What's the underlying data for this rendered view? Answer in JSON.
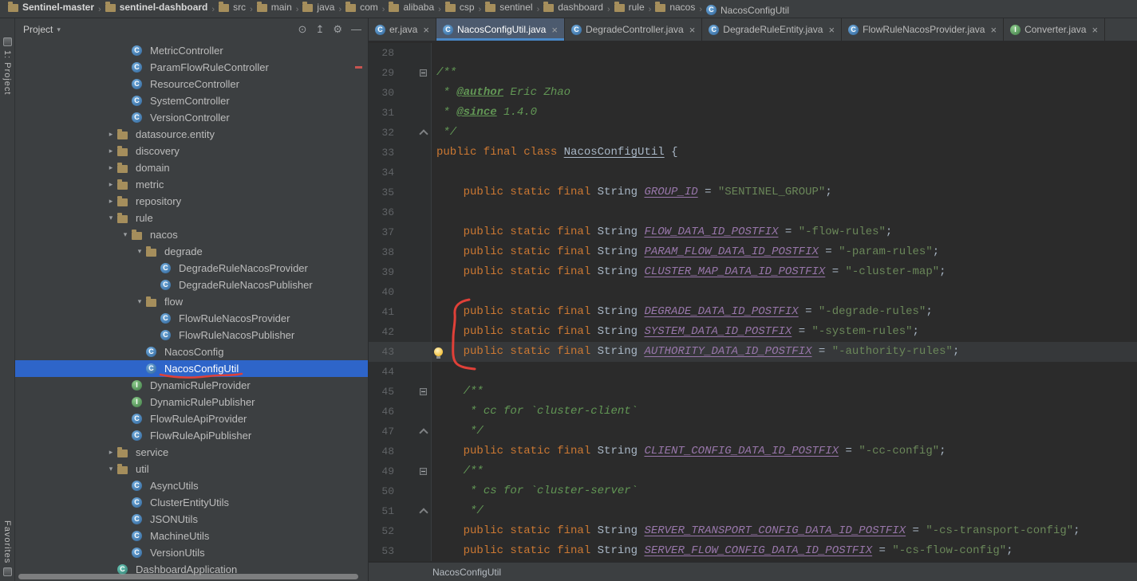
{
  "theme": {
    "panel_bg": "#3C3F41",
    "editor_bg": "#2B2B2B",
    "selection_blue": "#2E65C9",
    "tab_underline_blue": "#4A88C7",
    "annotation_red": "#E04038",
    "keyword_orange": "#CC7832",
    "string_green": "#6A8759",
    "constant_purple": "#9876AA"
  },
  "top_breadcrumbs": [
    {
      "label": "Sentinel-master",
      "icon": "folder",
      "bold": true
    },
    {
      "label": "sentinel-dashboard",
      "icon": "folder",
      "bold": true
    },
    {
      "label": "src",
      "icon": "folder",
      "bold": false
    },
    {
      "label": "main",
      "icon": "folder",
      "bold": false
    },
    {
      "label": "java",
      "icon": "folder",
      "bold": false
    },
    {
      "label": "com",
      "icon": "folder",
      "bold": false
    },
    {
      "label": "alibaba",
      "icon": "folder",
      "bold": false
    },
    {
      "label": "csp",
      "icon": "folder",
      "bold": false
    },
    {
      "label": "sentinel",
      "icon": "folder",
      "bold": false
    },
    {
      "label": "dashboard",
      "icon": "folder",
      "bold": false
    },
    {
      "label": "rule",
      "icon": "folder",
      "bold": false
    },
    {
      "label": "nacos",
      "icon": "folder",
      "bold": false
    },
    {
      "label": "NacosConfigUtil",
      "icon": "class",
      "bold": false
    }
  ],
  "tool_strip": {
    "top_label": "1: Project",
    "bottom_label": "Favorites"
  },
  "project_panel": {
    "title": "Project",
    "caret": "▾",
    "header_icons": [
      {
        "name": "locate-file-icon",
        "glyph": "⊙"
      },
      {
        "name": "collapse-all-icon",
        "glyph": "↥"
      },
      {
        "name": "settings-gear-icon",
        "glyph": "⚙"
      },
      {
        "name": "hide-panel-icon",
        "glyph": "—"
      }
    ],
    "tree": [
      {
        "label": "MetricController",
        "icon": "class",
        "depth": 7
      },
      {
        "label": "ParamFlowRuleController",
        "icon": "class",
        "depth": 7
      },
      {
        "label": "ResourceController",
        "icon": "class",
        "depth": 7
      },
      {
        "label": "SystemController",
        "icon": "class",
        "depth": 7
      },
      {
        "label": "VersionController",
        "icon": "class",
        "depth": 7
      },
      {
        "label": "datasource.entity",
        "icon": "folder",
        "depth": 6,
        "expand": "closed"
      },
      {
        "label": "discovery",
        "icon": "folder",
        "depth": 6,
        "expand": "closed"
      },
      {
        "label": "domain",
        "icon": "folder",
        "depth": 6,
        "expand": "closed"
      },
      {
        "label": "metric",
        "icon": "folder",
        "depth": 6,
        "expand": "closed"
      },
      {
        "label": "repository",
        "icon": "folder",
        "depth": 6,
        "expand": "closed"
      },
      {
        "label": "rule",
        "icon": "folder",
        "depth": 6,
        "expand": "open"
      },
      {
        "label": "nacos",
        "icon": "folder",
        "depth": 7,
        "expand": "open"
      },
      {
        "label": "degrade",
        "icon": "folder",
        "depth": 8,
        "expand": "open"
      },
      {
        "label": "DegradeRuleNacosProvider",
        "icon": "class",
        "depth": 9
      },
      {
        "label": "DegradeRuleNacosPublisher",
        "icon": "class",
        "depth": 9
      },
      {
        "label": "flow",
        "icon": "folder",
        "depth": 8,
        "expand": "open"
      },
      {
        "label": "FlowRuleNacosProvider",
        "icon": "class",
        "depth": 9
      },
      {
        "label": "FlowRuleNacosPublisher",
        "icon": "class",
        "depth": 9
      },
      {
        "label": "NacosConfig",
        "icon": "class",
        "depth": 8
      },
      {
        "label": "NacosConfigUtil",
        "icon": "class",
        "depth": 8,
        "selected": true
      },
      {
        "label": "DynamicRuleProvider",
        "icon": "interface",
        "depth": 7
      },
      {
        "label": "DynamicRulePublisher",
        "icon": "interface",
        "depth": 7
      },
      {
        "label": "FlowRuleApiProvider",
        "icon": "class",
        "depth": 7
      },
      {
        "label": "FlowRuleApiPublisher",
        "icon": "class",
        "depth": 7
      },
      {
        "label": "service",
        "icon": "folder",
        "depth": 6,
        "expand": "closed"
      },
      {
        "label": "util",
        "icon": "folder",
        "depth": 6,
        "expand": "open"
      },
      {
        "label": "AsyncUtils",
        "icon": "class",
        "depth": 7
      },
      {
        "label": "ClusterEntityUtils",
        "icon": "class",
        "depth": 7
      },
      {
        "label": "JSONUtils",
        "icon": "class",
        "depth": 7
      },
      {
        "label": "MachineUtils",
        "icon": "class",
        "depth": 7
      },
      {
        "label": "VersionUtils",
        "icon": "class",
        "depth": 7
      },
      {
        "label": "DashboardApplication",
        "icon": "app",
        "depth": 6
      }
    ]
  },
  "editor": {
    "tabs": [
      {
        "label": "er.java",
        "icon": "class",
        "active": false
      },
      {
        "label": "NacosConfigUtil.java",
        "icon": "class",
        "active": true
      },
      {
        "label": "DegradeController.java",
        "icon": "class",
        "active": false
      },
      {
        "label": "DegradeRuleEntity.java",
        "icon": "class",
        "active": false
      },
      {
        "label": "FlowRuleNacosProvider.java",
        "icon": "class",
        "active": false
      },
      {
        "label": "Converter.java",
        "icon": "interface",
        "active": false
      }
    ],
    "status_breadcrumb": "NacosConfigUtil",
    "lines": [
      {
        "no": 28,
        "seg": []
      },
      {
        "no": 29,
        "fold": "start",
        "seg": [
          {
            "s": "d",
            "t": "/**"
          }
        ]
      },
      {
        "no": 30,
        "seg": [
          {
            "s": "d",
            "t": " * "
          },
          {
            "s": "t",
            "t": "@author"
          },
          {
            "s": "d",
            "t": " Eric Zhao"
          }
        ]
      },
      {
        "no": 31,
        "seg": [
          {
            "s": "d",
            "t": " * "
          },
          {
            "s": "t",
            "t": "@since"
          },
          {
            "s": "d",
            "t": " 1.4.0"
          }
        ]
      },
      {
        "no": 32,
        "fold": "end",
        "seg": [
          {
            "s": "d",
            "t": " */"
          }
        ]
      },
      {
        "no": 33,
        "seg": [
          {
            "s": "k",
            "t": "public final class "
          },
          {
            "s": "n",
            "t": "NacosConfigUtil"
          },
          {
            "s": "p",
            "t": " {"
          }
        ]
      },
      {
        "no": 34,
        "seg": []
      },
      {
        "no": 35,
        "seg": [
          {
            "s": "p",
            "t": "    "
          },
          {
            "s": "k",
            "t": "public static final "
          },
          {
            "s": "p",
            "t": "String "
          },
          {
            "s": "c",
            "t": "GROUP_ID"
          },
          {
            "s": "p",
            "t": " = "
          },
          {
            "s": "s",
            "t": "\"SENTINEL_GROUP\""
          },
          {
            "s": "p",
            "t": ";"
          }
        ]
      },
      {
        "no": 36,
        "seg": []
      },
      {
        "no": 37,
        "seg": [
          {
            "s": "p",
            "t": "    "
          },
          {
            "s": "k",
            "t": "public static final "
          },
          {
            "s": "p",
            "t": "String "
          },
          {
            "s": "c",
            "t": "FLOW_DATA_ID_POSTFIX"
          },
          {
            "s": "p",
            "t": " = "
          },
          {
            "s": "s",
            "t": "\"-flow-rules\""
          },
          {
            "s": "p",
            "t": ";"
          }
        ]
      },
      {
        "no": 38,
        "seg": [
          {
            "s": "p",
            "t": "    "
          },
          {
            "s": "k",
            "t": "public static final "
          },
          {
            "s": "p",
            "t": "String "
          },
          {
            "s": "c",
            "t": "PARAM_FLOW_DATA_ID_POSTFIX"
          },
          {
            "s": "p",
            "t": " = "
          },
          {
            "s": "s",
            "t": "\"-param-rules\""
          },
          {
            "s": "p",
            "t": ";"
          }
        ]
      },
      {
        "no": 39,
        "seg": [
          {
            "s": "p",
            "t": "    "
          },
          {
            "s": "k",
            "t": "public static final "
          },
          {
            "s": "p",
            "t": "String "
          },
          {
            "s": "c",
            "t": "CLUSTER_MAP_DATA_ID_POSTFIX"
          },
          {
            "s": "p",
            "t": " = "
          },
          {
            "s": "s",
            "t": "\"-cluster-map\""
          },
          {
            "s": "p",
            "t": ";"
          }
        ]
      },
      {
        "no": 40,
        "seg": []
      },
      {
        "no": 41,
        "seg": [
          {
            "s": "p",
            "t": "    "
          },
          {
            "s": "k",
            "t": "public static final "
          },
          {
            "s": "p",
            "t": "String "
          },
          {
            "s": "c",
            "t": "DEGRADE_DATA_ID_POSTFIX"
          },
          {
            "s": "p",
            "t": " = "
          },
          {
            "s": "s",
            "t": "\"-degrade-rules\""
          },
          {
            "s": "p",
            "t": ";"
          }
        ]
      },
      {
        "no": 42,
        "seg": [
          {
            "s": "p",
            "t": "    "
          },
          {
            "s": "k",
            "t": "public static final "
          },
          {
            "s": "p",
            "t": "String "
          },
          {
            "s": "c",
            "t": "SYSTEM_DATA_ID_POSTFIX"
          },
          {
            "s": "p",
            "t": " = "
          },
          {
            "s": "s",
            "t": "\"-system-rules\""
          },
          {
            "s": "p",
            "t": ";"
          }
        ]
      },
      {
        "no": 43,
        "hl": true,
        "bulb": true,
        "seg": [
          {
            "s": "p",
            "t": "    "
          },
          {
            "s": "k",
            "t": "public static final "
          },
          {
            "s": "p",
            "t": "String "
          },
          {
            "s": "c",
            "t": "AUTHORITY_DATA_ID_POSTFIX"
          },
          {
            "s": "p",
            "t": " = "
          },
          {
            "s": "s",
            "t": "\"-authority-rules\""
          },
          {
            "s": "p",
            "t": ";"
          }
        ]
      },
      {
        "no": 44,
        "seg": []
      },
      {
        "no": 45,
        "fold": "start",
        "seg": [
          {
            "s": "p",
            "t": "    "
          },
          {
            "s": "d",
            "t": "/**"
          }
        ]
      },
      {
        "no": 46,
        "seg": [
          {
            "s": "p",
            "t": "    "
          },
          {
            "s": "d",
            "t": " * cc for `cluster-client`"
          }
        ]
      },
      {
        "no": 47,
        "fold": "end",
        "seg": [
          {
            "s": "p",
            "t": "    "
          },
          {
            "s": "d",
            "t": " */"
          }
        ]
      },
      {
        "no": 48,
        "seg": [
          {
            "s": "p",
            "t": "    "
          },
          {
            "s": "k",
            "t": "public static final "
          },
          {
            "s": "p",
            "t": "String "
          },
          {
            "s": "c",
            "t": "CLIENT_CONFIG_DATA_ID_POSTFIX"
          },
          {
            "s": "p",
            "t": " = "
          },
          {
            "s": "s",
            "t": "\"-cc-config\""
          },
          {
            "s": "p",
            "t": ";"
          }
        ]
      },
      {
        "no": 49,
        "fold": "start",
        "seg": [
          {
            "s": "p",
            "t": "    "
          },
          {
            "s": "d",
            "t": "/**"
          }
        ]
      },
      {
        "no": 50,
        "seg": [
          {
            "s": "p",
            "t": "    "
          },
          {
            "s": "d",
            "t": " * cs for `cluster-server`"
          }
        ]
      },
      {
        "no": 51,
        "fold": "end",
        "seg": [
          {
            "s": "p",
            "t": "    "
          },
          {
            "s": "d",
            "t": " */"
          }
        ]
      },
      {
        "no": 52,
        "seg": [
          {
            "s": "p",
            "t": "    "
          },
          {
            "s": "k",
            "t": "public static final "
          },
          {
            "s": "p",
            "t": "String "
          },
          {
            "s": "c",
            "t": "SERVER_TRANSPORT_CONFIG_DATA_ID_POSTFIX"
          },
          {
            "s": "p",
            "t": " = "
          },
          {
            "s": "s",
            "t": "\"-cs-transport-config\""
          },
          {
            "s": "p",
            "t": ";"
          }
        ]
      },
      {
        "no": 53,
        "seg": [
          {
            "s": "p",
            "t": "    "
          },
          {
            "s": "k",
            "t": "public static final "
          },
          {
            "s": "p",
            "t": "String "
          },
          {
            "s": "c",
            "t": "SERVER_FLOW_CONFIG_DATA_ID_POSTFIX"
          },
          {
            "s": "p",
            "t": " = "
          },
          {
            "s": "s",
            "t": "\"-cs-flow-config\""
          },
          {
            "s": "p",
            "t": ";"
          }
        ]
      }
    ]
  }
}
